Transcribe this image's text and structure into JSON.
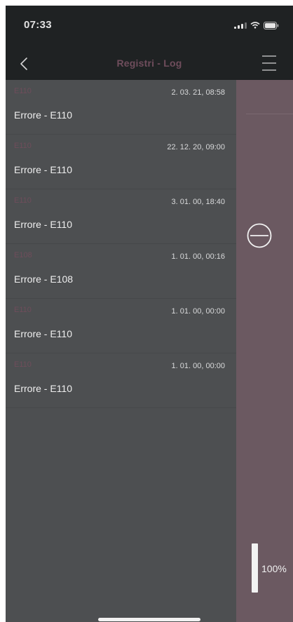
{
  "status_bar": {
    "time": "07:33",
    "icons": [
      "cellular-signal-icon",
      "wifi-icon",
      "battery-icon"
    ]
  },
  "nav": {
    "title": "Registri - Log",
    "back_icon": "chevron-left-icon",
    "menu_icon": "hamburger-menu-icon"
  },
  "log": {
    "entries": [
      {
        "code": "E110",
        "date": "2. 03. 21, 08:58",
        "message": "Errore - E110"
      },
      {
        "code": "E110",
        "date": "22. 12. 20, 09:00",
        "message": "Errore - E110"
      },
      {
        "code": "E110",
        "date": "3. 01. 00, 18:40",
        "message": "Errore - E110"
      },
      {
        "code": "E108",
        "date": "1. 01. 00, 00:16",
        "message": "Errore - E108"
      },
      {
        "code": "E110",
        "date": "1. 01. 00, 00:00",
        "message": "Errore - E110"
      },
      {
        "code": "E110",
        "date": "1. 01. 00, 00:00",
        "message": "Errore - E110"
      }
    ]
  },
  "side_panel": {
    "remove_icon": "minus-circle-icon",
    "level_value": "100%",
    "level_fraction": 1.0
  },
  "colors": {
    "background": "#4d4f51",
    "header": "#1f2223",
    "side_panel": "#6b5961",
    "accent_code": "#6e4d5b"
  }
}
